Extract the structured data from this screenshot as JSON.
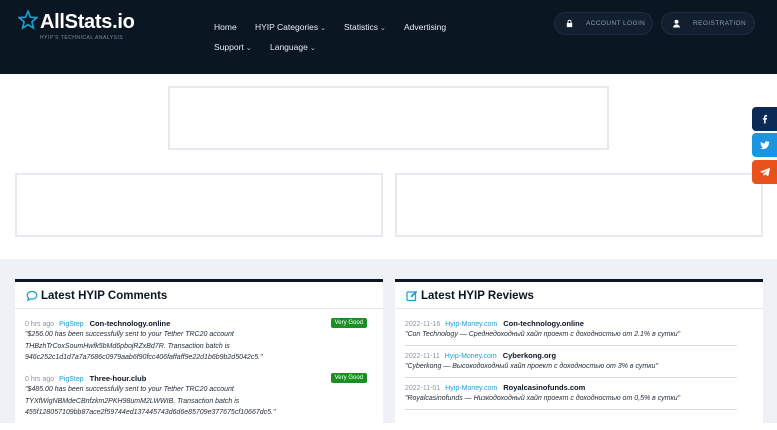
{
  "logo": {
    "name": "AllStats.io",
    "tagline": "HYIP'S TECHNICAL ANALYSIS"
  },
  "nav": {
    "home": "Home",
    "hyip_categories": "HYIP Categories",
    "statistics": "Statistics",
    "advertising": "Advertising",
    "support": "Support",
    "language": "Language"
  },
  "auth": {
    "login": "ACCOUNT LOGIN",
    "register": "REGISTRATION"
  },
  "comments": {
    "title": "Latest HYIP Comments",
    "items": [
      {
        "time": "0 hrs ago",
        "user": "PigStep",
        "site": "Con-technology.online",
        "badge": "Very Good",
        "text": "\"$256.00 has been successfully sent to your Tether TRC20 account THBzhTrCoxSoumHwfk5bMd6pbojRZxBd7R. Transaction batch is 946c252c1d1d7a7a7686c0979aab6f90fcc406faffaff9e22d1b6b9b2d5042c5.\""
      },
      {
        "time": "0 hrs ago",
        "user": "PigStep",
        "site": "Three-hour.club",
        "badge": "Very Good",
        "text": "\"$485.00 has been successfully sent to your Tether TRC20 account TYXfWigNBMdeCBnfzkm2PKH98umM2LWWIB. Transaction batch is 455f128057109bb87ace2f59744ed137445743d6d6e85709e377675cf10667dc5.\""
      }
    ]
  },
  "reviews": {
    "title": "Latest HYIP Reviews",
    "items": [
      {
        "date": "2022-11-16",
        "source": "Hyip-Money.com",
        "site": "Con-technology.online",
        "text": "\"Con Technology — Среднедоходный хайп проект с доходностью от 2.1% в сутки\""
      },
      {
        "date": "2022-11-11",
        "source": "Hyip-Money.com",
        "site": "Cyberkong.org",
        "text": "\"Cyberkong — Высокодоходный хайп проект с доходностью от 3% в сутки\""
      },
      {
        "date": "2022-11-01",
        "source": "Hyip-Money.com",
        "site": "Royalcasinofunds.com",
        "text": "\"Royalcasinofunds — Низкодоходный хайп проект с доходностью от 0,5% в сутки\""
      }
    ]
  },
  "colors": {
    "header_bg": "#0b1623",
    "link": "#1a9fd0",
    "badge_green": "#1c8f24",
    "facebook": "#0b2a55",
    "twitter": "#1b95e0",
    "telegram": "#e8501c"
  },
  "icons": [
    "star-logo-icon",
    "lock-icon",
    "user-icon",
    "comment-icon",
    "edit-icon",
    "facebook-icon",
    "twitter-icon",
    "telegram-icon",
    "chevron-down-icon"
  ]
}
